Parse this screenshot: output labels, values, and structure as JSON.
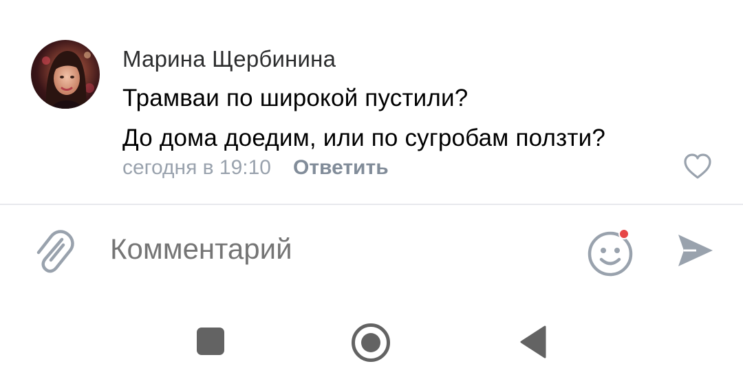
{
  "comment": {
    "author": "Марина Щербинина",
    "lines": [
      "Трамваи по широкой пустили?",
      "До дома доедим, или по сугробам ползти?"
    ],
    "time": "сегодня в 19:10",
    "reply_label": "Ответить",
    "avatar_icon": "user-avatar-photo",
    "like_icon": "heart-outline-icon"
  },
  "composer": {
    "placeholder": "Комментарий",
    "attach_icon": "paperclip-icon",
    "emoji_icon": "smile-icon",
    "send_icon": "send-arrow-icon",
    "emoji_badge_color": "#e64646"
  },
  "system_nav": {
    "recent_icon": "square-recent-apps-icon",
    "home_icon": "circle-home-icon",
    "back_icon": "triangle-back-icon"
  }
}
